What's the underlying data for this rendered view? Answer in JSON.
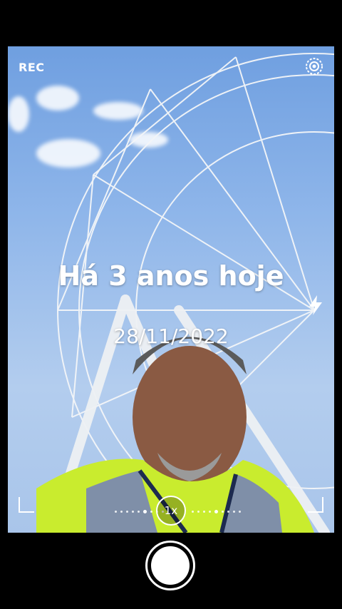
{
  "status": {
    "rec_label": "REC"
  },
  "memory": {
    "title": "Há 3 anos hoje",
    "date": "28/11/2022"
  },
  "zoom": {
    "level": "1x"
  },
  "icons": {
    "settings": "settings-gear-icon",
    "flash": "flash-icon"
  },
  "colors": {
    "background": "#000000",
    "overlay_text": "#ffffff",
    "sky": "#8fb6ea"
  }
}
